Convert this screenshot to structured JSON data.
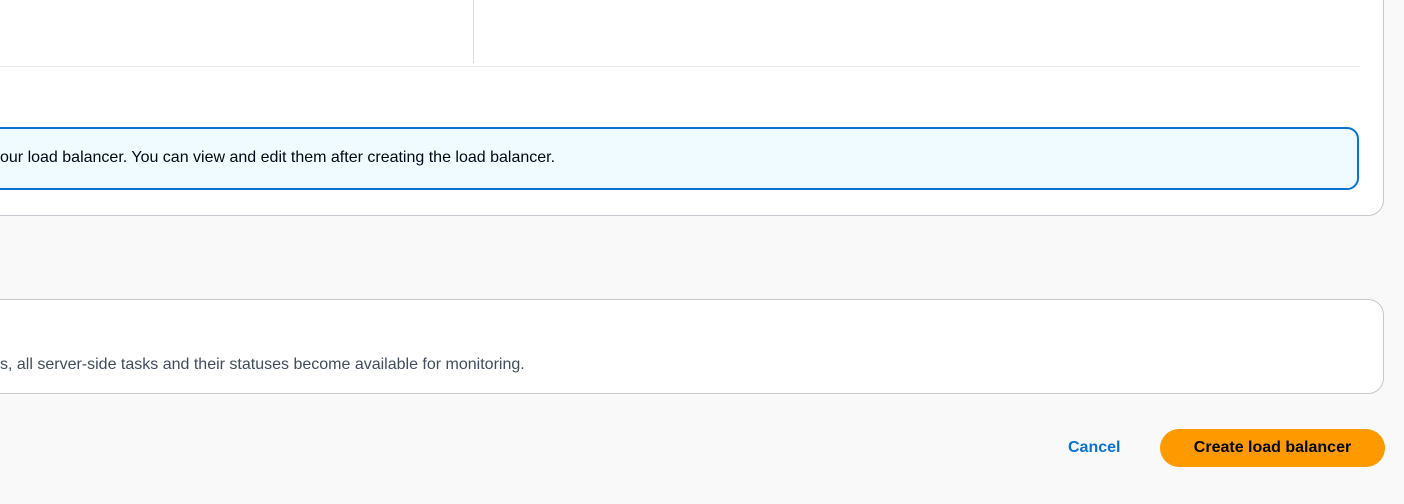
{
  "info_alert": {
    "text": "our load balancer. You can view and edit them after creating the load balancer."
  },
  "monitoring_section": {
    "text": "s, all server-side tasks and their statuses become available for monitoring."
  },
  "actions": {
    "cancel_label": "Cancel",
    "create_label": "Create load balancer"
  },
  "colors": {
    "primary_button": "#ff9900",
    "link": "#0972d3",
    "info_border": "#0972d3",
    "info_background": "#f0fbff"
  }
}
